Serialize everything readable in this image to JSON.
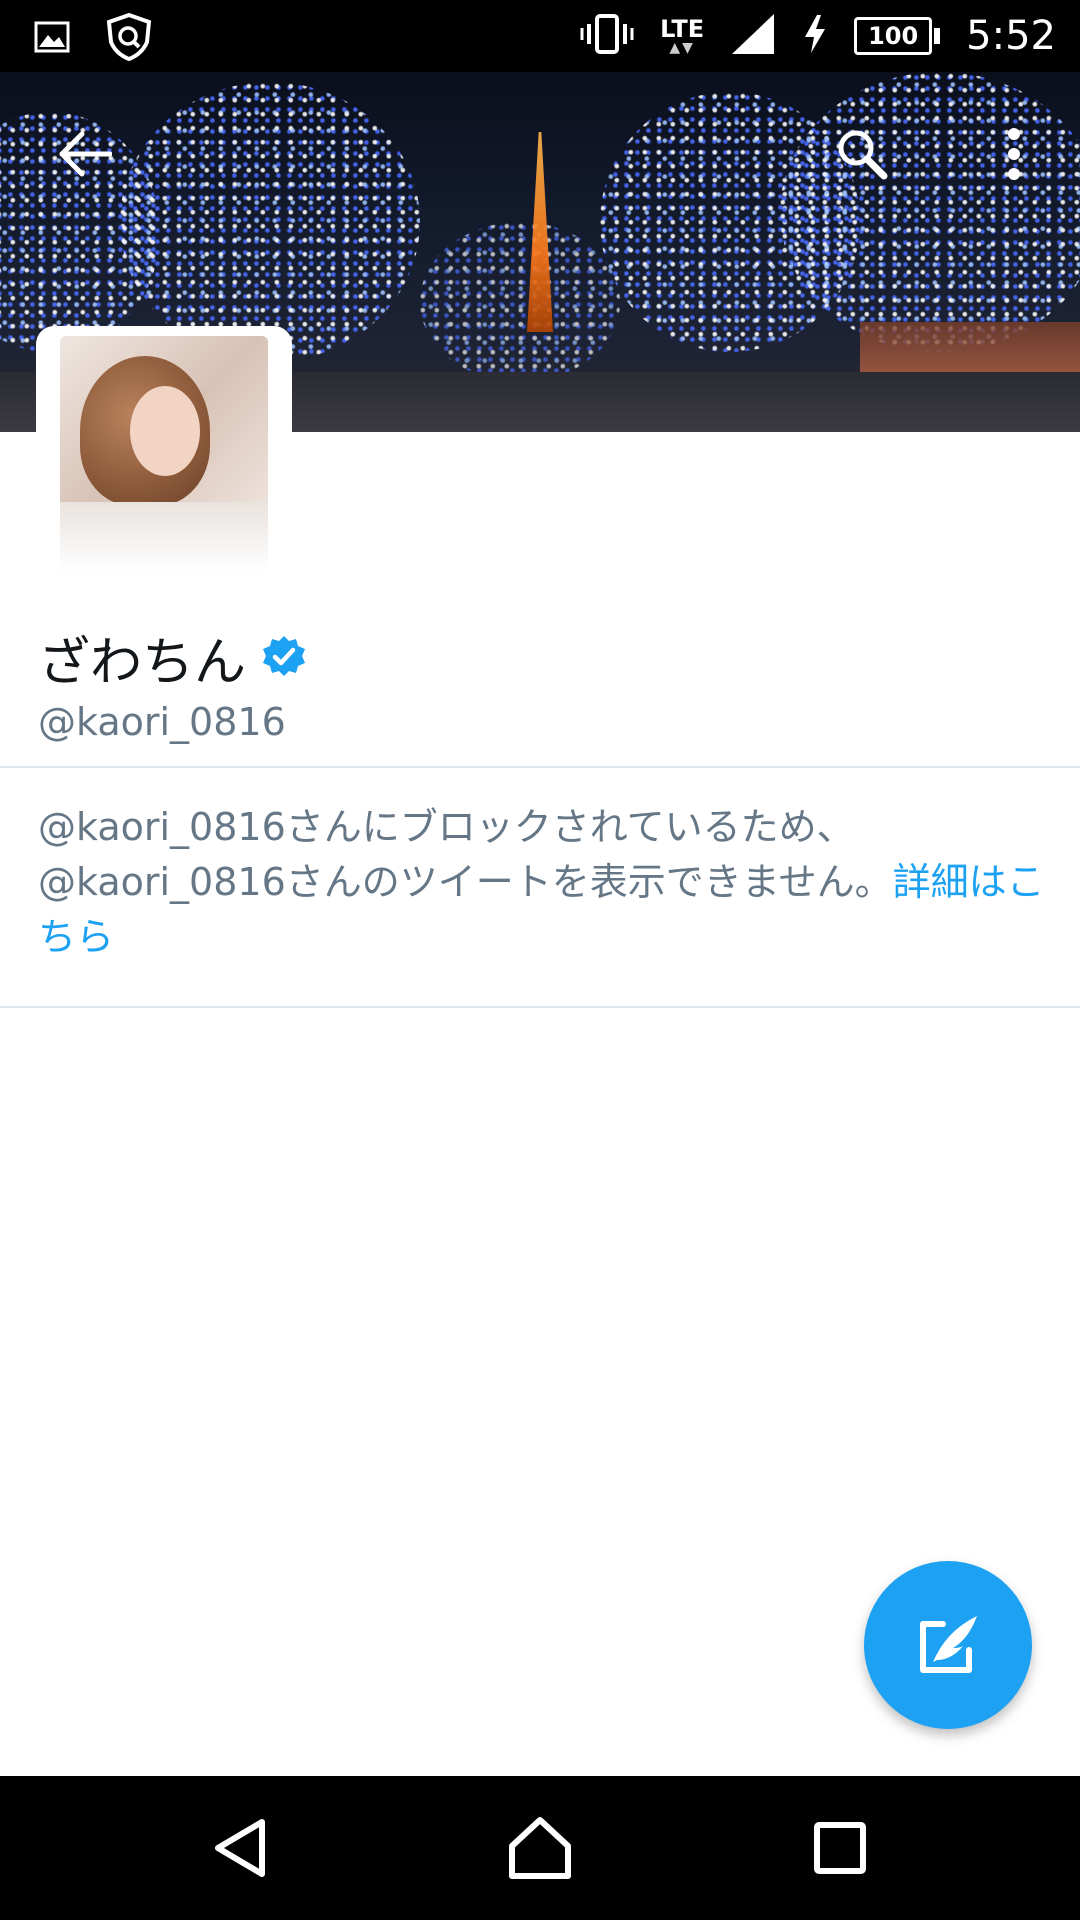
{
  "status_bar": {
    "network": "LTE",
    "network_arrows": "▲▼",
    "battery": "100",
    "time": "5:52",
    "icons": [
      "gallery-icon",
      "security-icon",
      "vibrate-icon",
      "signal-icon",
      "charging-icon"
    ]
  },
  "header": {
    "back_icon": "arrow-left-icon",
    "search_icon": "search-icon",
    "more_icon": "more-vertical-icon"
  },
  "profile": {
    "name": "ざわちん",
    "verified": true,
    "handle": "@kaori_0816"
  },
  "blocked_message": {
    "text": "@kaori_0816さんにブロックされているため、@kaori_0816さんのツイートを表示できません。",
    "link_text": "詳細はこちら"
  },
  "fab": {
    "icon": "compose-tweet-icon"
  },
  "colors": {
    "accent": "#1da1f2",
    "text_primary": "#14171a",
    "text_secondary": "#657786",
    "divider": "#e1e8ed"
  },
  "nav_bar": {
    "icons": [
      "back-triangle-icon",
      "home-icon",
      "recents-icon"
    ]
  }
}
